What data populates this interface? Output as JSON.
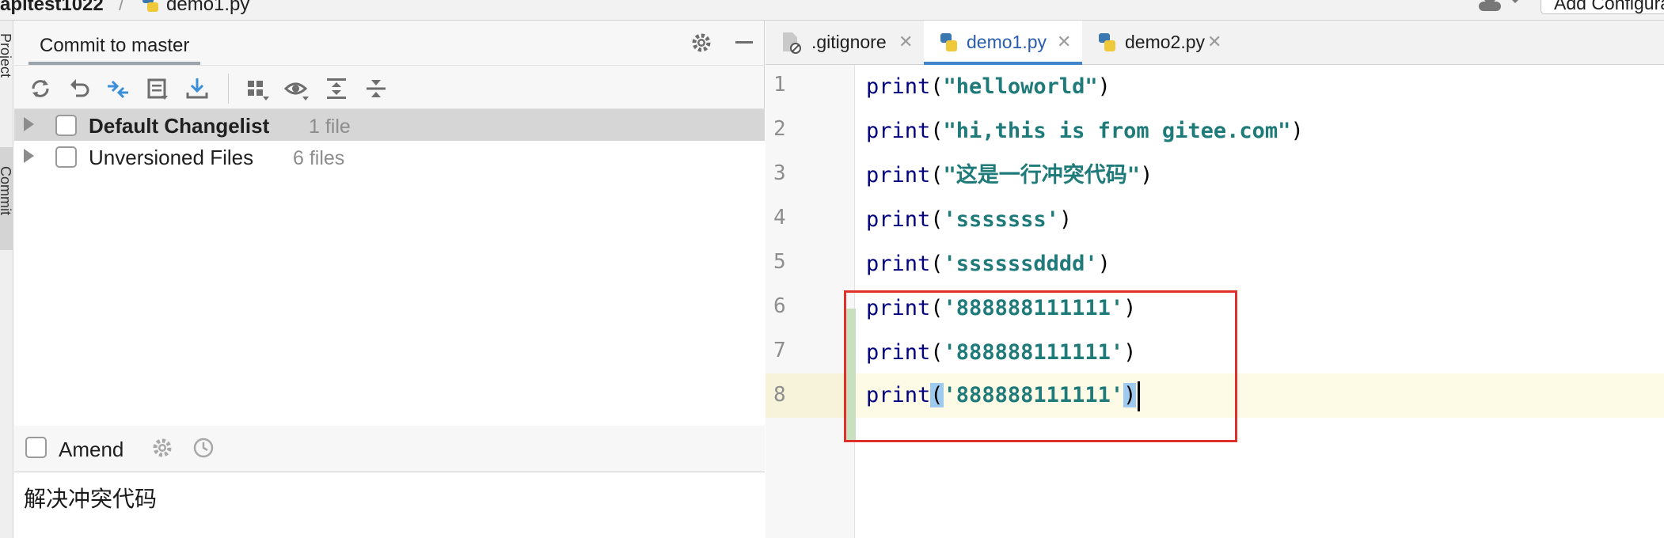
{
  "breadcrumb": {
    "project": "apitest1022",
    "separator": "/",
    "file": "demo1.py"
  },
  "run_config": {
    "label": "Add Configuration..."
  },
  "toolstrip": {
    "project_tab": "Project",
    "commit_tab": "Commit"
  },
  "commit_panel": {
    "title": "Commit to master",
    "changelists": [
      {
        "name": "Default Changelist",
        "count": "1 file",
        "selected": true
      },
      {
        "name": "Unversioned Files",
        "count": "6 files",
        "selected": false
      }
    ],
    "amend_label": "Amend",
    "commit_message": "解决冲突代码"
  },
  "editor": {
    "tabs": [
      {
        "label": ".gitignore",
        "active": false
      },
      {
        "label": "demo1.py",
        "active": true
      },
      {
        "label": "demo2.py",
        "active": false
      }
    ],
    "lines": [
      {
        "number": "1",
        "keyword": "print",
        "open": "(",
        "string": "\"helloworld\"",
        "close": ")"
      },
      {
        "number": "2",
        "keyword": "print",
        "open": "(",
        "string": "\"hi,this is from gitee.com\"",
        "close": ")"
      },
      {
        "number": "3",
        "keyword": "print",
        "open": "(",
        "string": "\"这是一行冲突代码\"",
        "close": ")"
      },
      {
        "number": "4",
        "keyword": "print",
        "open": "(",
        "string": "'sssssss'",
        "close": ")"
      },
      {
        "number": "5",
        "keyword": "print",
        "open": "(",
        "string": "'ssssssdddd'",
        "close": ")"
      },
      {
        "number": "6",
        "keyword": "print",
        "open": "(",
        "string": "'888888111111'",
        "close": ")"
      },
      {
        "number": "7",
        "keyword": "print",
        "open": "(",
        "string": "'888888111111'",
        "close": ")"
      },
      {
        "number": "8",
        "keyword": "print",
        "open": "(",
        "string": "'888888111111'",
        "close": ")"
      }
    ],
    "current_line": "8"
  },
  "colors": {
    "highlight_box": "#e0302b",
    "active_tab_accent": "#4083c9",
    "keyword": "#000080",
    "string": "#067d17"
  },
  "icons": {
    "toolbar": [
      "refresh-icon",
      "rollback-icon",
      "diff-icon",
      "shelve-icon",
      "update-icon",
      "group-by-icon",
      "view-options-icon",
      "expand-all-icon",
      "collapse-all-icon"
    ],
    "tabs": [
      "gitignore-file-icon",
      "python-file-icon",
      "python-file-icon"
    ]
  }
}
